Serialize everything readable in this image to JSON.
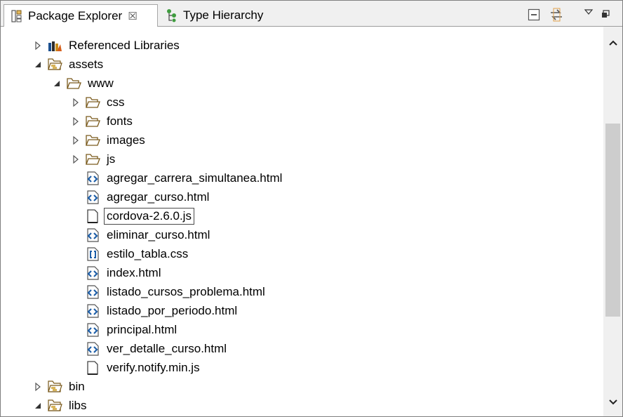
{
  "tabs": [
    {
      "label": "Package Explorer",
      "active": true,
      "close_symbol": "☒"
    },
    {
      "label": "Type Hierarchy",
      "active": false
    }
  ],
  "toolbar": {
    "collapse_all": "collapse-all-icon",
    "link_with_editor": "link-with-editor-icon",
    "view_menu": "view-menu-icon",
    "maximize": "maximize-icon"
  },
  "tree": [
    {
      "label": "Referenced Libraries",
      "indent": 0,
      "expand": "collapsed",
      "icon": "library"
    },
    {
      "label": "assets",
      "indent": 0,
      "expand": "expanded",
      "icon": "source-folder"
    },
    {
      "label": "www",
      "indent": 1,
      "expand": "expanded",
      "icon": "folder-open"
    },
    {
      "label": "css",
      "indent": 2,
      "expand": "collapsed",
      "icon": "folder-open"
    },
    {
      "label": "fonts",
      "indent": 2,
      "expand": "collapsed",
      "icon": "folder-open"
    },
    {
      "label": "images",
      "indent": 2,
      "expand": "collapsed",
      "icon": "folder-open"
    },
    {
      "label": "js",
      "indent": 2,
      "expand": "collapsed",
      "icon": "folder-open"
    },
    {
      "label": "agregar_carrera_simultanea.html",
      "indent": 2,
      "expand": "none",
      "icon": "html-file"
    },
    {
      "label": "agregar_curso.html",
      "indent": 2,
      "expand": "none",
      "icon": "html-file"
    },
    {
      "label": "cordova-2.6.0.js",
      "indent": 2,
      "expand": "none",
      "icon": "text-file",
      "selected": true
    },
    {
      "label": "eliminar_curso.html",
      "indent": 2,
      "expand": "none",
      "icon": "html-file"
    },
    {
      "label": "estilo_tabla.css",
      "indent": 2,
      "expand": "none",
      "icon": "css-file"
    },
    {
      "label": "index.html",
      "indent": 2,
      "expand": "none",
      "icon": "html-file"
    },
    {
      "label": "listado_cursos_problema.html",
      "indent": 2,
      "expand": "none",
      "icon": "html-file"
    },
    {
      "label": "listado_por_periodo.html",
      "indent": 2,
      "expand": "none",
      "icon": "html-file"
    },
    {
      "label": "principal.html",
      "indent": 2,
      "expand": "none",
      "icon": "html-file"
    },
    {
      "label": "ver_detalle_curso.html",
      "indent": 2,
      "expand": "none",
      "icon": "html-file"
    },
    {
      "label": "verify.notify.min.js",
      "indent": 2,
      "expand": "none",
      "icon": "text-file"
    },
    {
      "label": "bin",
      "indent": 0,
      "expand": "collapsed",
      "icon": "source-folder"
    },
    {
      "label": "libs",
      "indent": 0,
      "expand": "expanded",
      "icon": "source-folder"
    }
  ],
  "scrollbar": {
    "up": "chevron-up-icon",
    "down": "chevron-down-icon"
  },
  "colors": {
    "folder": "#c9a24a",
    "html_icon": "#1f5fa8",
    "tab_bg": "#f0f0f0",
    "selection_border": "#4a4a4a"
  }
}
